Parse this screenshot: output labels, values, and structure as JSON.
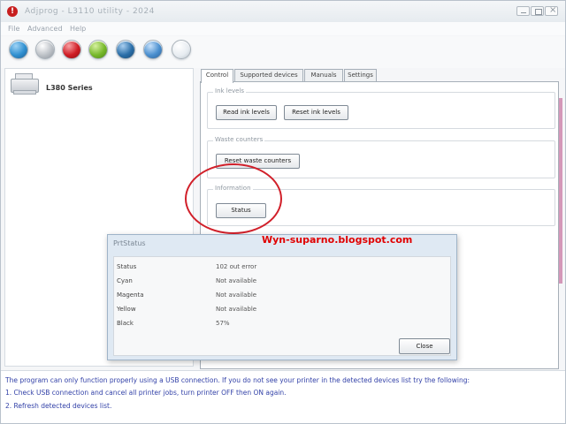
{
  "window": {
    "title": "Adjprog - L3110 utility - 2024"
  },
  "menu": [
    "File",
    "Advanced",
    "Help"
  ],
  "toolbar": {
    "icons": [
      {
        "name": "refresh-icon",
        "color": "#2f8fd0"
      },
      {
        "name": "check-icon",
        "color": "#b8bdc3"
      },
      {
        "name": "stop-icon",
        "color": "#cf1c24"
      },
      {
        "name": "info-icon",
        "color": "#76b82a"
      },
      {
        "name": "globe-icon",
        "color": "#2a6ea8"
      },
      {
        "name": "tools-icon",
        "color": "#4a8fcf"
      },
      {
        "name": "printer-icon",
        "color": "#e6ebf0"
      }
    ]
  },
  "sidebar": {
    "printer_name": "L380 Series"
  },
  "tabs": [
    "Control",
    "Supported devices",
    "Manuals",
    "Settings"
  ],
  "groups": {
    "ink": {
      "label": "Ink levels",
      "read_button": "Read ink levels",
      "reset_button": "Reset ink levels"
    },
    "waste": {
      "label": "Waste counters",
      "reset_button": "Reset waste counters"
    },
    "info": {
      "label": "Information",
      "status_button": "Status"
    }
  },
  "watermark": "Wyn-suparno.blogspot.com",
  "dialog": {
    "title": "PrtStatus",
    "rows": [
      {
        "label": "Status",
        "value": "102 out error"
      },
      {
        "label": "Cyan",
        "value": "Not available"
      },
      {
        "label": "Magenta",
        "value": "Not available"
      },
      {
        "label": "Yellow",
        "value": "Not available"
      },
      {
        "label": "Black",
        "value": "57%"
      }
    ],
    "close_button": "Close"
  },
  "footer": {
    "lines": [
      "The program can only function properly using a USB connection. If you do not see your printer in the detected devices list try the following:",
      "1. Check USB connection and cancel all printer jobs, turn printer OFF then ON again.",
      "2. Refresh detected devices list."
    ]
  }
}
